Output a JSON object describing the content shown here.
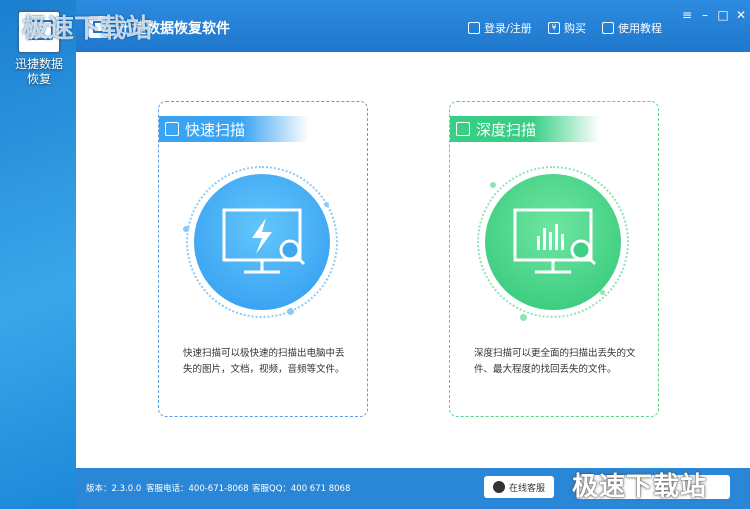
{
  "desktop": {
    "icon_label": "迅捷数据恢复"
  },
  "watermark": {
    "top": "极速下载站",
    "bottom": "极速下载站"
  },
  "window": {
    "title": "迅捷数据恢复软件",
    "links": {
      "login": "登录/注册",
      "buy": "购买",
      "tutorial": "使用教程"
    },
    "buttons": {
      "menu": "≡",
      "minimize": "–",
      "maximize": "□",
      "close": "✕"
    }
  },
  "cards": [
    {
      "title": "快速扫描",
      "description": "快速扫描可以极快速的扫描出电脑中丢失的图片，文档，视频，音频等文件。"
    },
    {
      "title": "深度扫描",
      "description": "深度扫描可以更全面的扫描出丢失的文件、最大程度的找回丢失的文件。"
    }
  ],
  "footer": {
    "version": "版本：2.3.0.0",
    "phone": "客服电话：400-671-8068",
    "qq": "客服QQ：400 671 8068",
    "service": "在线客服"
  },
  "colors": {
    "accent_blue": "#2f9af0",
    "accent_green": "#2fc676",
    "titlebar": "#1f78cc"
  }
}
